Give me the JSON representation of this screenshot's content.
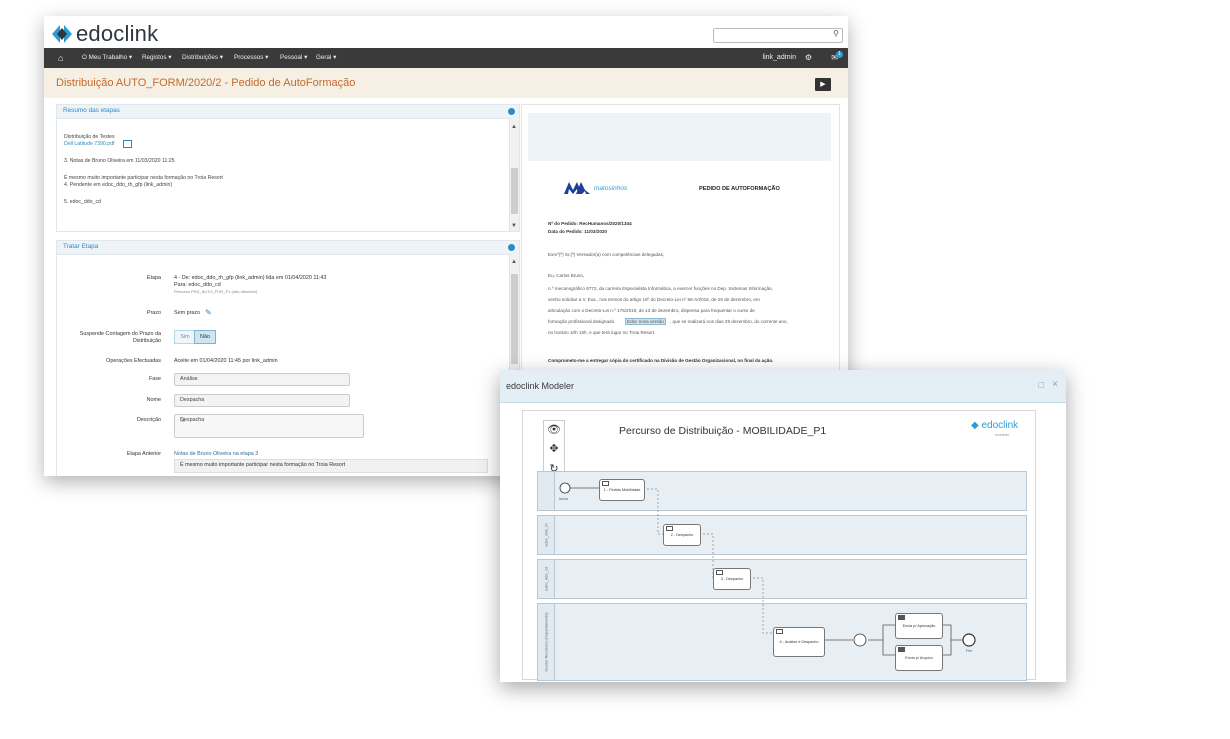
{
  "app": {
    "brand": "edoclink",
    "nav": {
      "home_icon": "home-icon",
      "items": [
        "O Meu Trabalho ▾",
        "Registos ▾",
        "Distribuições ▾",
        "Processos ▾",
        "Pessoal ▾",
        "Geral ▾"
      ],
      "user": "link_admin",
      "notifications_count": "1"
    },
    "page_title": "Distribuição AUTO_FORM/2020/2 - Pedido de AutoFormação",
    "resumo": {
      "title": "Resumo das etapas",
      "lines": [
        "Distribuição de Testes",
        "Dell Latitude 7390.pdf",
        "3. Notas de Bruno Oliveira em 11/03/2020 11:25",
        "É mesmo muito importante participar nesta formação no Troia Resort",
        "4. Pendente em edoc_ddo_rh_gfp (link_admin)",
        "5. edoc_ddo_cd"
      ]
    },
    "tratar": {
      "title": "Tratar Etapa",
      "etapa_label": "Etapa",
      "etapa_line1": "4 - De: edoc_ddo_rh_gfp (link_admin) lida em 01/04/2020 11:43",
      "etapa_line2": "Para: edoc_ddo_cd",
      "etapa_line3": "Percurso PED_AUTO_FOR_P1 (não alterável)",
      "prazo_label": "Prazo",
      "prazo_value": "Sem prazo",
      "suspende_label_1": "Suspende Contagem do Prazo da",
      "suspende_label_2": "Distribuição",
      "sim": "Sim",
      "nao": "Não",
      "operacoes_label": "Operações Efectuadas",
      "operacoes_value": "Aceite em 01/04/2020 11:45 por link_admin",
      "fase_label": "Fase",
      "fase_value": "Análise",
      "nome_label": "Nome",
      "nome_value": "Despacha",
      "descricao_label": "Descrição",
      "descricao_value": "Despacha",
      "anterior_label": "Etapa Anterior",
      "anterior_value": "Notas de Bruno Oliveira na etapa 3",
      "anterior_note": "É mesmo muito importante participar nesta formação no Troia Resort"
    },
    "doc": {
      "org": "matosinhos",
      "heading": "PEDIDO DE AUTOFORMAÇÃO",
      "pedido": "Nº do Pedido: RecHumanos/2020/1344",
      "data": "Data do Pedido: 11/03/2020",
      "greeting": "Exmº(ª) Sr.(ª) Vereador(a) com competências delegadas,",
      "eu": "Eu, Carlos Bruno,",
      "p1": "n.º mecanográfico 6772, da carreira Especialista Informática, a exercer funções no Dep. Sistemas Informação,",
      "p2": "venho solicitar a V. Exa., nos termos do artigo 16º do Decreto-Lei nº 86-A/2016, de 29 de dezembro, em",
      "p3": "articulação com o Decreto-Lei n.º 175/2019, de 13 de dezembro, dispensa para frequentar o curso de",
      "p4a": "formação profissional designado",
      "p4b": "Edoc nova versão",
      "p4c": ", que se realizará nos dias 29 dezembro, do corrente ano,",
      "p5": "no horário 10h 15h, e que terá lugar no Troia Resort.",
      "commit": "Comprometo-me a entregar cópia do certificado na Divisão de Gestão Organizacional, no final da ação."
    }
  },
  "modeler": {
    "window_title": "edoclink Modeler",
    "process_title": "Percurso de Distribuição - MOBILIDADE_P1",
    "brand": "edoclink",
    "brand_sub": "modeler",
    "tools": [
      "eye-icon",
      "move-icon",
      "refresh-icon",
      "connect-icon"
    ],
    "lanes": [
      "",
      "edoc_ddo_rh",
      "edoc_ddo_cd",
      "Gestor Recursos (Departamento)"
    ],
    "tasks": [
      "1 - Pedido Mobilidade",
      "2 - Despacho",
      "3 - Despacho",
      "4 - Análise e Despacho",
      "Envia p/ Aprovação",
      "Envia p/ Arquivo"
    ],
    "start_label": "Início",
    "end_label": "Fim"
  }
}
